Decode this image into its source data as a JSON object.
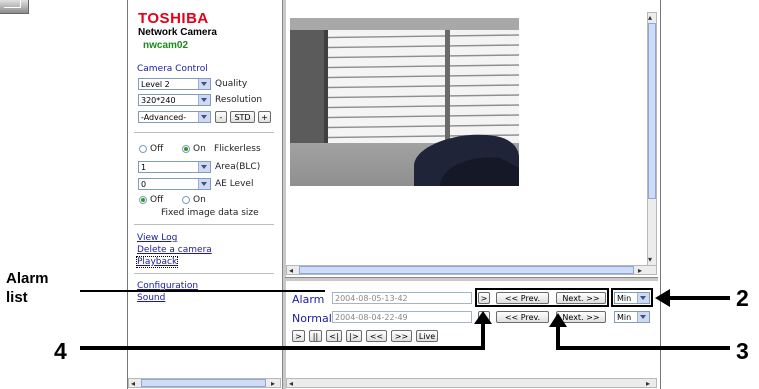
{
  "brand": {
    "logo": "TOSHIBA",
    "product": "Network Camera",
    "camera_name": "nwcam02"
  },
  "camera_control": {
    "heading": "Camera Control",
    "quality": {
      "value": "Level 2",
      "label": "Quality"
    },
    "resolution": {
      "value": "320*240",
      "label": "Resolution"
    },
    "advanced": {
      "value": "-Advanced-",
      "minus": "-",
      "std": "STD",
      "plus": "+"
    }
  },
  "flickerless": {
    "off": "Off",
    "on": "On",
    "label": "Flickerless"
  },
  "area": {
    "value": "1",
    "label": "Area(BLC)"
  },
  "ae_level": {
    "value": "0",
    "label": "AE Level"
  },
  "fixed_size": {
    "off": "Off",
    "on": "On",
    "label": "Fixed image data size"
  },
  "links": {
    "view_log": "View Log",
    "delete_camera": "Delete a camera",
    "playback": "Playback",
    "configuration": "Configuration",
    "sound": "Sound"
  },
  "playback": {
    "alarm": {
      "label": "Alarm",
      "value": "2004-08-05-13-42",
      "go": ">",
      "prev": "<< Prev.",
      "next": "Next. >>",
      "unit": "Min"
    },
    "normal": {
      "label": "Normal",
      "value": "2004-08-04-22-49",
      "go": ">",
      "prev": "<< Prev.",
      "next": "Next. >>",
      "unit": "Min"
    },
    "controls": {
      "play": ">",
      "pause": "||",
      "step_back": "<|",
      "step_fwd": "|>",
      "rewind": "<<",
      "ffwd": ">>",
      "live": "Live"
    }
  },
  "callouts": {
    "alarm_list": "Alarm\nlist",
    "n2": "2",
    "n3": "3",
    "n4": "4"
  },
  "colors": {
    "logo_red": "#e2001a",
    "link_blue": "#1a1aa6",
    "camera_name_green": "#1a8a1a"
  }
}
